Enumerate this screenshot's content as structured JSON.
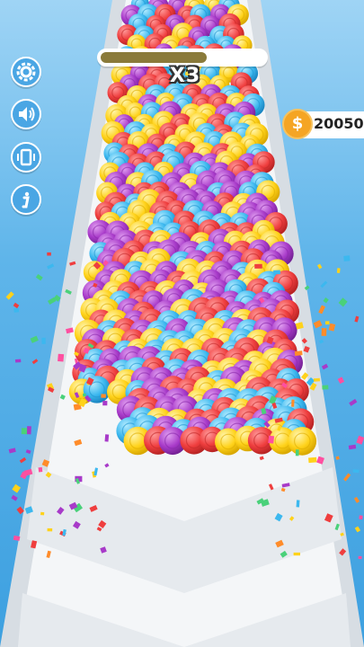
{
  "hud": {
    "buttons": [
      {
        "name": "settings-button",
        "icon": "gear-icon"
      },
      {
        "name": "sound-button",
        "icon": "speaker-icon"
      },
      {
        "name": "vibration-button",
        "icon": "vibration-icon"
      },
      {
        "name": "info-button",
        "icon": "info-icon"
      }
    ],
    "progress_fraction": 0.65,
    "multiplier_label": "X3",
    "coins": "20050",
    "coin_symbol": "$"
  },
  "colors": {
    "ball_yellow": "#ffd21a",
    "ball_red": "#ef3e3e",
    "ball_purple": "#a83ac9",
    "ball_cyan": "#3cb8ef",
    "hud_blue": "#4aa6e4",
    "coin_orange": "#f5a524",
    "sky": "#5fb5ea"
  }
}
